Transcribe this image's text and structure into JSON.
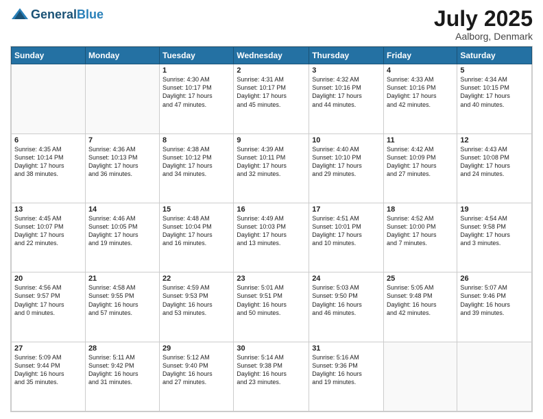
{
  "header": {
    "logo_general": "General",
    "logo_blue": "Blue",
    "month_title": "July 2025",
    "location": "Aalborg, Denmark"
  },
  "days_of_week": [
    "Sunday",
    "Monday",
    "Tuesday",
    "Wednesday",
    "Thursday",
    "Friday",
    "Saturday"
  ],
  "weeks": [
    [
      {
        "day": "",
        "text": ""
      },
      {
        "day": "",
        "text": ""
      },
      {
        "day": "1",
        "text": "Sunrise: 4:30 AM\nSunset: 10:17 PM\nDaylight: 17 hours\nand 47 minutes."
      },
      {
        "day": "2",
        "text": "Sunrise: 4:31 AM\nSunset: 10:17 PM\nDaylight: 17 hours\nand 45 minutes."
      },
      {
        "day": "3",
        "text": "Sunrise: 4:32 AM\nSunset: 10:16 PM\nDaylight: 17 hours\nand 44 minutes."
      },
      {
        "day": "4",
        "text": "Sunrise: 4:33 AM\nSunset: 10:16 PM\nDaylight: 17 hours\nand 42 minutes."
      },
      {
        "day": "5",
        "text": "Sunrise: 4:34 AM\nSunset: 10:15 PM\nDaylight: 17 hours\nand 40 minutes."
      }
    ],
    [
      {
        "day": "6",
        "text": "Sunrise: 4:35 AM\nSunset: 10:14 PM\nDaylight: 17 hours\nand 38 minutes."
      },
      {
        "day": "7",
        "text": "Sunrise: 4:36 AM\nSunset: 10:13 PM\nDaylight: 17 hours\nand 36 minutes."
      },
      {
        "day": "8",
        "text": "Sunrise: 4:38 AM\nSunset: 10:12 PM\nDaylight: 17 hours\nand 34 minutes."
      },
      {
        "day": "9",
        "text": "Sunrise: 4:39 AM\nSunset: 10:11 PM\nDaylight: 17 hours\nand 32 minutes."
      },
      {
        "day": "10",
        "text": "Sunrise: 4:40 AM\nSunset: 10:10 PM\nDaylight: 17 hours\nand 29 minutes."
      },
      {
        "day": "11",
        "text": "Sunrise: 4:42 AM\nSunset: 10:09 PM\nDaylight: 17 hours\nand 27 minutes."
      },
      {
        "day": "12",
        "text": "Sunrise: 4:43 AM\nSunset: 10:08 PM\nDaylight: 17 hours\nand 24 minutes."
      }
    ],
    [
      {
        "day": "13",
        "text": "Sunrise: 4:45 AM\nSunset: 10:07 PM\nDaylight: 17 hours\nand 22 minutes."
      },
      {
        "day": "14",
        "text": "Sunrise: 4:46 AM\nSunset: 10:05 PM\nDaylight: 17 hours\nand 19 minutes."
      },
      {
        "day": "15",
        "text": "Sunrise: 4:48 AM\nSunset: 10:04 PM\nDaylight: 17 hours\nand 16 minutes."
      },
      {
        "day": "16",
        "text": "Sunrise: 4:49 AM\nSunset: 10:03 PM\nDaylight: 17 hours\nand 13 minutes."
      },
      {
        "day": "17",
        "text": "Sunrise: 4:51 AM\nSunset: 10:01 PM\nDaylight: 17 hours\nand 10 minutes."
      },
      {
        "day": "18",
        "text": "Sunrise: 4:52 AM\nSunset: 10:00 PM\nDaylight: 17 hours\nand 7 minutes."
      },
      {
        "day": "19",
        "text": "Sunrise: 4:54 AM\nSunset: 9:58 PM\nDaylight: 17 hours\nand 3 minutes."
      }
    ],
    [
      {
        "day": "20",
        "text": "Sunrise: 4:56 AM\nSunset: 9:57 PM\nDaylight: 17 hours\nand 0 minutes."
      },
      {
        "day": "21",
        "text": "Sunrise: 4:58 AM\nSunset: 9:55 PM\nDaylight: 16 hours\nand 57 minutes."
      },
      {
        "day": "22",
        "text": "Sunrise: 4:59 AM\nSunset: 9:53 PM\nDaylight: 16 hours\nand 53 minutes."
      },
      {
        "day": "23",
        "text": "Sunrise: 5:01 AM\nSunset: 9:51 PM\nDaylight: 16 hours\nand 50 minutes."
      },
      {
        "day": "24",
        "text": "Sunrise: 5:03 AM\nSunset: 9:50 PM\nDaylight: 16 hours\nand 46 minutes."
      },
      {
        "day": "25",
        "text": "Sunrise: 5:05 AM\nSunset: 9:48 PM\nDaylight: 16 hours\nand 42 minutes."
      },
      {
        "day": "26",
        "text": "Sunrise: 5:07 AM\nSunset: 9:46 PM\nDaylight: 16 hours\nand 39 minutes."
      }
    ],
    [
      {
        "day": "27",
        "text": "Sunrise: 5:09 AM\nSunset: 9:44 PM\nDaylight: 16 hours\nand 35 minutes."
      },
      {
        "day": "28",
        "text": "Sunrise: 5:11 AM\nSunset: 9:42 PM\nDaylight: 16 hours\nand 31 minutes."
      },
      {
        "day": "29",
        "text": "Sunrise: 5:12 AM\nSunset: 9:40 PM\nDaylight: 16 hours\nand 27 minutes."
      },
      {
        "day": "30",
        "text": "Sunrise: 5:14 AM\nSunset: 9:38 PM\nDaylight: 16 hours\nand 23 minutes."
      },
      {
        "day": "31",
        "text": "Sunrise: 5:16 AM\nSunset: 9:36 PM\nDaylight: 16 hours\nand 19 minutes."
      },
      {
        "day": "",
        "text": ""
      },
      {
        "day": "",
        "text": ""
      }
    ]
  ]
}
